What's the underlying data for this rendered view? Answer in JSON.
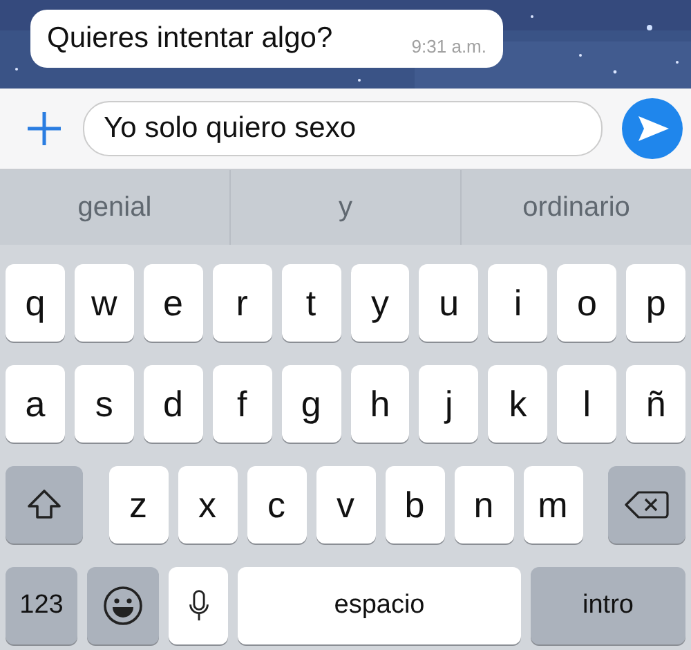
{
  "message": {
    "text": "Quieres intentar algo?",
    "time": "9:31 a.m."
  },
  "composer": {
    "value": "Yo solo quiero sexo"
  },
  "suggestions": [
    "genial",
    "y",
    "ordinario"
  ],
  "keyboard": {
    "rows": [
      [
        "q",
        "w",
        "e",
        "r",
        "t",
        "y",
        "u",
        "i",
        "o",
        "p"
      ],
      [
        "a",
        "s",
        "d",
        "f",
        "g",
        "h",
        "j",
        "k",
        "l",
        "ñ"
      ],
      [
        "z",
        "x",
        "c",
        "v",
        "b",
        "n",
        "m"
      ]
    ],
    "numbers_key": "123",
    "space_key": "espacio",
    "return_key": "intro"
  }
}
